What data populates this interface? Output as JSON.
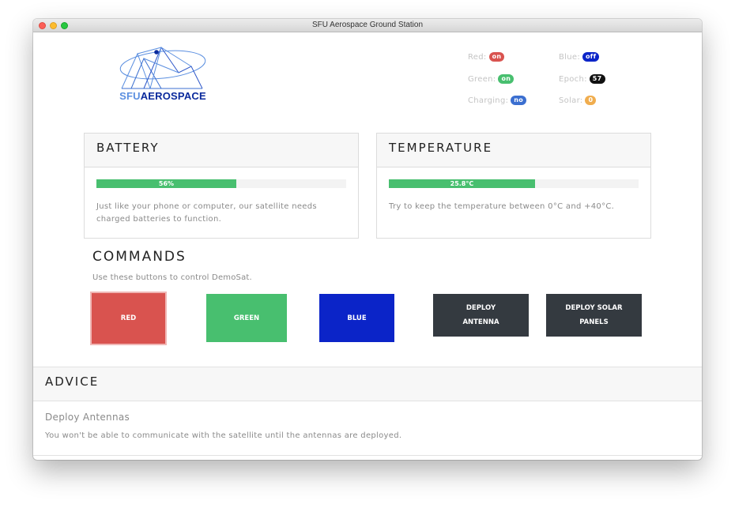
{
  "window": {
    "title": "SFU Aerospace Ground Station"
  },
  "logo": {
    "part1": "SFU",
    "part2": "AEROSPACE"
  },
  "status": {
    "red": {
      "label": "Red:",
      "value": "on",
      "color": "#d9534f"
    },
    "blue": {
      "label": "Blue:",
      "value": "off",
      "color": "#0b24c8"
    },
    "green": {
      "label": "Green:",
      "value": "on",
      "color": "#48bf6f"
    },
    "epoch": {
      "label": "Epoch:",
      "value": "57",
      "color": "#111111"
    },
    "charging": {
      "label": "Charging:",
      "value": "no",
      "color": "#3b6fd0"
    },
    "solar": {
      "label": "Solar:",
      "value": "0",
      "color": "#f0ad4e"
    }
  },
  "battery": {
    "title": "BATTERY",
    "progress_label": "56%",
    "progress_fraction": 0.56,
    "description": "Just like your phone or computer, our satellite needs charged batteries to function."
  },
  "temperature": {
    "title": "TEMPERATURE",
    "progress_label": "25.8°C",
    "progress_fraction": 0.585,
    "description": "Try to keep the temperature between 0°C and +40°C."
  },
  "commands": {
    "title": "COMMANDS",
    "subtitle": "Use these buttons to control DemoSat.",
    "buttons": {
      "red": "RED",
      "green": "GREEN",
      "blue": "BLUE",
      "deploy_antenna_line1": "DEPLOY",
      "deploy_antenna_line2": "ANTENNA",
      "deploy_solar_line1": "DEPLOY SOLAR",
      "deploy_solar_line2": "PANELS"
    },
    "colors": {
      "red": "#d9534f",
      "green": "#48bf6f",
      "blue": "#0b24c8",
      "dark": "#343a40"
    }
  },
  "advice": {
    "title": "ADVICE",
    "item_title": "Deploy Antennas",
    "item_text": "You won't be able to communicate with the satellite until the antennas are deployed."
  }
}
